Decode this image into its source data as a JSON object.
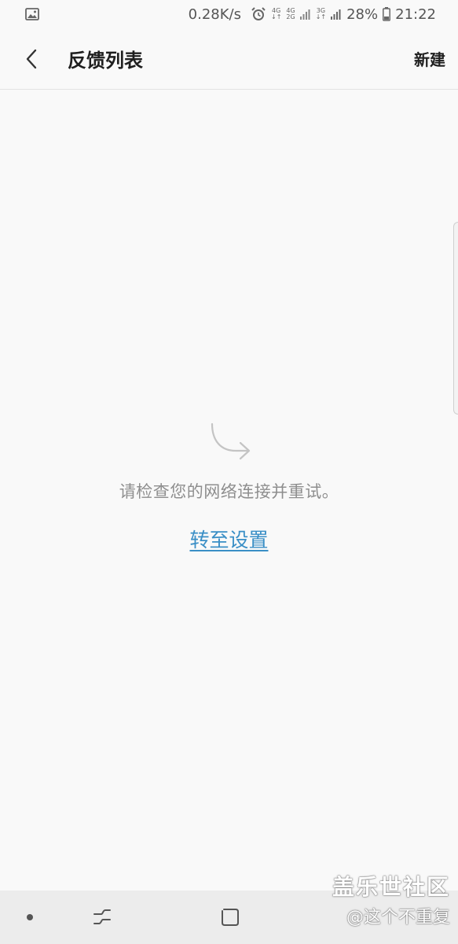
{
  "status_bar": {
    "network_speed": "0.28K/s",
    "net_4g_top": "4G",
    "net_4g_bottom": "4G",
    "net_2g": "2G",
    "net_3g": "3G",
    "battery": "28%",
    "time": "21:22",
    "icons": [
      "gallery-icon",
      "alarm-icon",
      "signal-icon",
      "battery-icon"
    ]
  },
  "header": {
    "title": "反馈列表",
    "new_label": "新建"
  },
  "empty_state": {
    "message": "请检查您的网络连接并重试。",
    "link_label": "转至设置",
    "icon": "redirect-arrow-icon"
  },
  "watermark": {
    "line1": "盖乐世社区",
    "line2": "@这个不重复"
  },
  "nav_bar": {
    "items": [
      "dot-icon",
      "recent-apps-icon",
      "home-icon"
    ]
  },
  "colors": {
    "background": "#f9f9f9",
    "link": "#3a8fc6",
    "muted_text": "#8e8e8e",
    "nav_background": "#ececec"
  }
}
